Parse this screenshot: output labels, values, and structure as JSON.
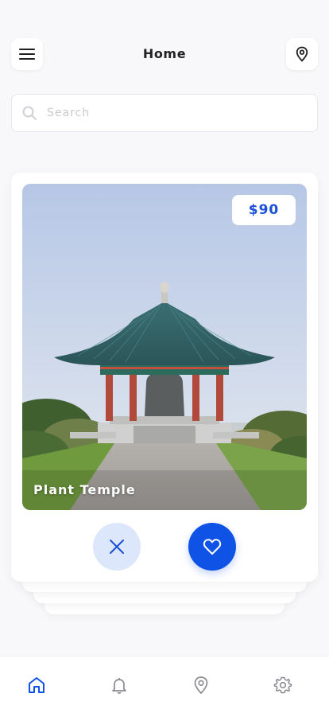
{
  "header": {
    "title": "Home",
    "menu_icon": "hamburger-menu-icon",
    "location_icon": "map-pin-icon"
  },
  "search": {
    "placeholder": "Search",
    "value": "",
    "icon": "search-icon"
  },
  "card": {
    "place_name": "Plant Temple",
    "price": "$90",
    "reject_icon": "close-icon",
    "like_icon": "heart-icon"
  },
  "tabbar": {
    "items": [
      {
        "icon": "home-icon",
        "active": true
      },
      {
        "icon": "bell-icon",
        "active": false
      },
      {
        "icon": "map-pin-icon",
        "active": false
      },
      {
        "icon": "gear-icon",
        "active": false
      }
    ]
  },
  "colors": {
    "accent": "#0f53e6",
    "accent_light": "#dde7fb",
    "price_text": "#1a4fd8",
    "background": "#f8f8fa",
    "inactive_icon": "#8a8a92"
  }
}
